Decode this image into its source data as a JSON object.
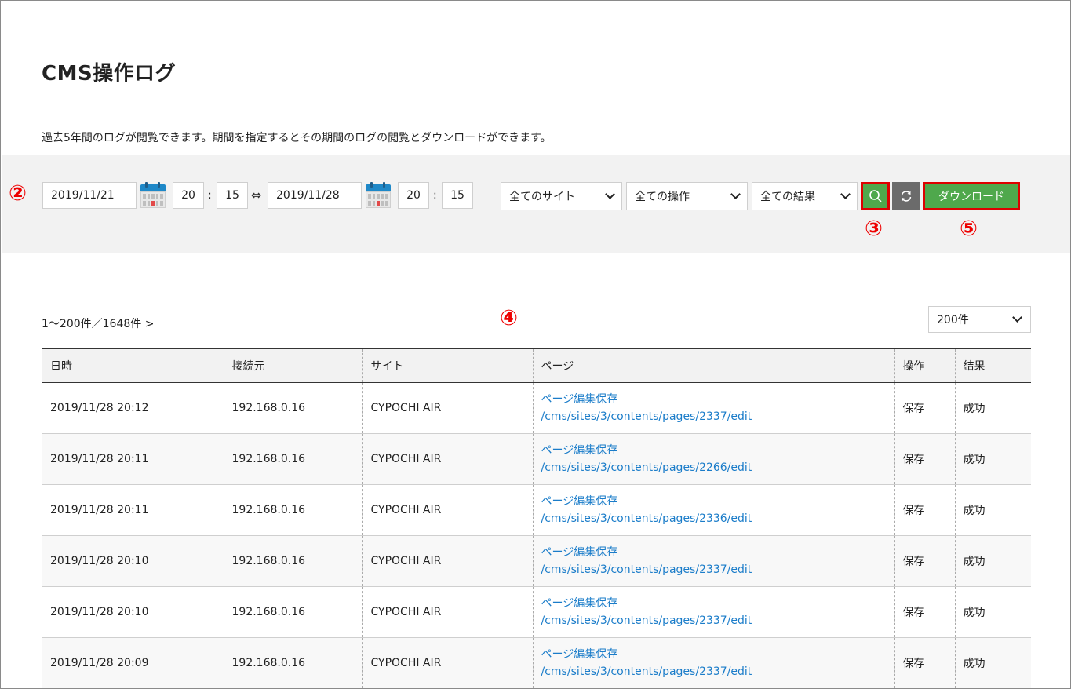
{
  "page": {
    "title": "CMS操作ログ",
    "intro": "過去5年間のログが閲覧できます。期間を指定するとその期間のログの閲覧とダウンロードができます。"
  },
  "annotations": {
    "filter": "②",
    "search": "③",
    "table": "④",
    "download": "⑤"
  },
  "filter": {
    "start_date": "2019/11/21",
    "start_hour": "20",
    "start_minute": "15",
    "range_symbol": "⇔",
    "end_date": "2019/11/28",
    "end_hour": "20",
    "end_minute": "15",
    "time_separator": ":",
    "site_select": "全てのサイト",
    "operation_select": "全ての操作",
    "result_select": "全ての結果",
    "search_icon": "search-icon",
    "reset_icon": "refresh-icon",
    "download_label": "ダウンロード",
    "calendar_icon": "calendar-icon"
  },
  "pager": {
    "summary": "1～200件／1648件 >",
    "per_page": "200件"
  },
  "table": {
    "headers": [
      "日時",
      "接続元",
      "サイト",
      "ページ",
      "操作",
      "結果"
    ],
    "rows": [
      {
        "datetime": "2019/11/28 20:12",
        "source": "192.168.0.16",
        "site": "CYPOCHI AIR",
        "page_title": "ページ編集保存",
        "page_path": "/cms/sites/3/contents/pages/2337/edit",
        "operation": "保存",
        "result": "成功"
      },
      {
        "datetime": "2019/11/28 20:11",
        "source": "192.168.0.16",
        "site": "CYPOCHI AIR",
        "page_title": "ページ編集保存",
        "page_path": "/cms/sites/3/contents/pages/2266/edit",
        "operation": "保存",
        "result": "成功"
      },
      {
        "datetime": "2019/11/28 20:11",
        "source": "192.168.0.16",
        "site": "CYPOCHI AIR",
        "page_title": "ページ編集保存",
        "page_path": "/cms/sites/3/contents/pages/2336/edit",
        "operation": "保存",
        "result": "成功"
      },
      {
        "datetime": "2019/11/28 20:10",
        "source": "192.168.0.16",
        "site": "CYPOCHI AIR",
        "page_title": "ページ編集保存",
        "page_path": "/cms/sites/3/contents/pages/2337/edit",
        "operation": "保存",
        "result": "成功"
      },
      {
        "datetime": "2019/11/28 20:10",
        "source": "192.168.0.16",
        "site": "CYPOCHI AIR",
        "page_title": "ページ編集保存",
        "page_path": "/cms/sites/3/contents/pages/2337/edit",
        "operation": "保存",
        "result": "成功"
      },
      {
        "datetime": "2019/11/28 20:09",
        "source": "192.168.0.16",
        "site": "CYPOCHI AIR",
        "page_title": "ページ編集保存",
        "page_path": "/cms/sites/3/contents/pages/2337/edit",
        "operation": "保存",
        "result": "成功"
      }
    ]
  },
  "colors": {
    "accent_green": "#4fa84c",
    "annotation_red": "#e00000",
    "link_blue": "#1a7cc9"
  }
}
